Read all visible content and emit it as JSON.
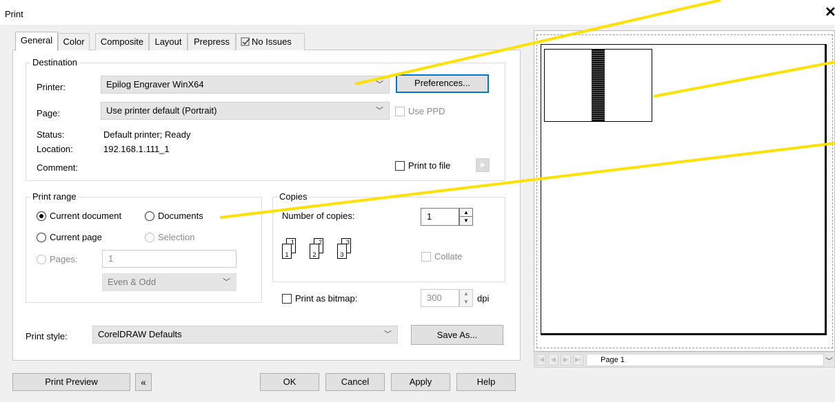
{
  "window": {
    "title": "Print",
    "close_glyph": "✕"
  },
  "tabs": [
    {
      "label": "General",
      "active": true
    },
    {
      "label": "Color"
    },
    {
      "label": "Composite"
    },
    {
      "label": "Layout"
    },
    {
      "label": "Prepress"
    },
    {
      "label": "No Issues",
      "icon": "issues-check-icon"
    }
  ],
  "destination": {
    "label": "Destination",
    "printer_label": "Printer:",
    "printer_value": "Epilog Engraver WinX64",
    "preferences_button": "Preferences...",
    "page_label": "Page:",
    "page_value": "Use printer default (Portrait)",
    "use_ppd_label": "Use PPD",
    "status_label": "Status:",
    "status_value": "Default printer; Ready",
    "location_label": "Location:",
    "location_value": "192.168.1.111_1",
    "comment_label": "Comment:",
    "print_to_file_label": "Print to file"
  },
  "print_range": {
    "label": "Print range",
    "current_document": "Current document",
    "documents": "Documents",
    "current_page": "Current page",
    "selection": "Selection",
    "pages_label": "Pages:",
    "pages_value": "1",
    "even_odd": "Even & Odd",
    "selected": "current_document"
  },
  "copies": {
    "label": "Copies",
    "number_label": "Number of copies:",
    "number_value": "1",
    "collate_label": "Collate",
    "collate_icon_pages": [
      "1",
      "1",
      "2",
      "2",
      "3",
      "3"
    ]
  },
  "bitmap": {
    "label": "Print as bitmap:",
    "dpi_value": "300",
    "dpi_unit": "dpi"
  },
  "print_style": {
    "label": "Print style:",
    "value": "CorelDRAW Defaults",
    "save_as_button": "Save As..."
  },
  "footer": {
    "print_preview": "Print Preview",
    "collapse_glyph": "«",
    "ok": "OK",
    "cancel": "Cancel",
    "apply": "Apply",
    "help": "Help"
  },
  "preview": {
    "page_label": "Page 1",
    "nav_glyphs": [
      "|◀",
      "◀",
      "▶",
      "▶|"
    ],
    "annotation_color": "#ffe100"
  }
}
